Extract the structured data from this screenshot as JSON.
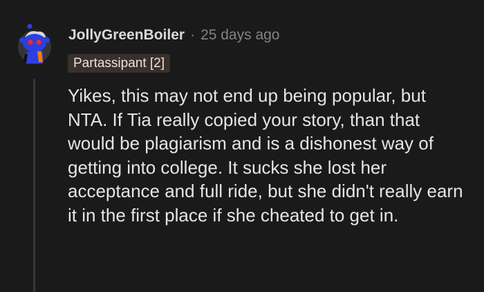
{
  "comment": {
    "username": "JollyGreenBoiler",
    "separator": "·",
    "timestamp": "25 days ago",
    "flair": "Partassipant [2]",
    "body": "Yikes, this may not end up being popular, but NTA. If Tia really copied your story, than that would be plagiarism and is a dishonest way of getting into college. It sucks she lost her acceptance and full ride, but she didn't really earn it in the first place if she cheated to get in.",
    "avatar": "snoo-avatar-icon"
  },
  "colors": {
    "background": "#1a1a1b",
    "text": "#d7dadc",
    "muted": "#818384",
    "flair_bg": "#3a2f2b",
    "thread_line": "#343536",
    "avatar_blue": "#2d3fe0",
    "avatar_red": "#ff2a1a",
    "avatar_orange": "#ff7a00"
  }
}
